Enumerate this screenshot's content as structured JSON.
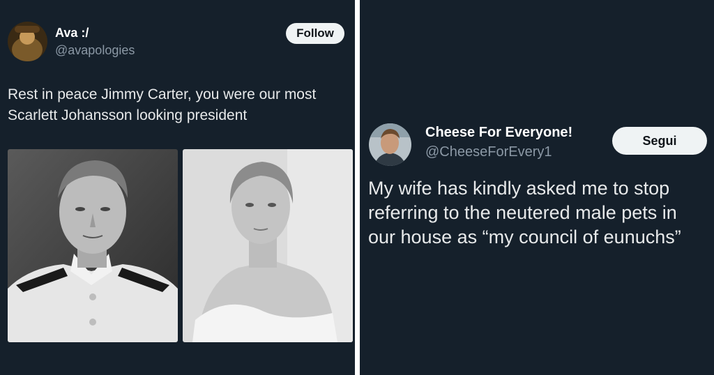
{
  "left_tweet": {
    "display_name": "Ava :/",
    "handle": "@avapologies",
    "follow_label": "Follow",
    "text_lines": [
      "Rest in peace Jimmy Carter, you were our most",
      "Scarlett Johansson looking president"
    ],
    "images": [
      "jimmy-carter-navy-portrait",
      "scarlett-johansson-portrait"
    ]
  },
  "right_tweet": {
    "display_name": "Cheese For Everyone!",
    "handle": "@CheeseForEvery1",
    "follow_label": "Segui",
    "text_lines": [
      "My wife has kindly asked me to stop",
      "referring to the neutered male pets in",
      "our house as “my council of eunuchs”"
    ]
  },
  "colors": {
    "background": "#15202b",
    "divider": "#ffffff",
    "primary_text": "#e7e9ea",
    "secondary_text": "#8b98a5",
    "button_bg": "#eff3f4",
    "button_text": "#0f1419"
  }
}
